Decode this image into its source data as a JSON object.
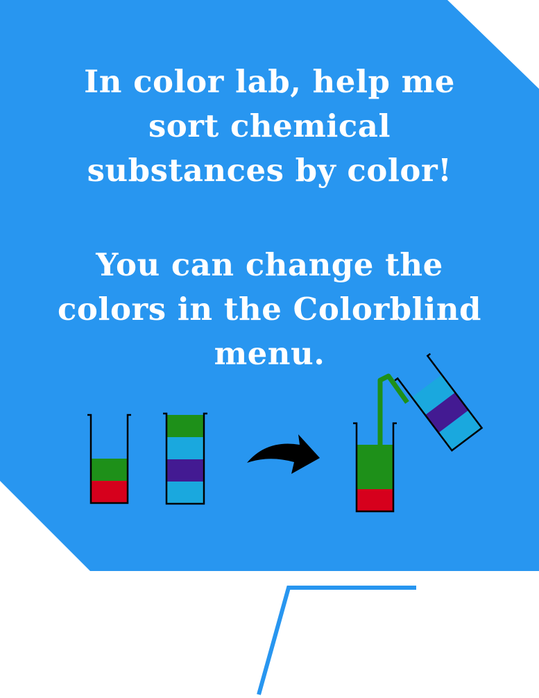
{
  "tutorial": {
    "message_lines": [
      "In color lab, help me",
      "sort chemical",
      "substances by color!"
    ],
    "hint_lines": [
      "You can change the",
      "colors in the Colorblind",
      "menu."
    ]
  },
  "colors": {
    "panel_blue": "#2896f0",
    "green": "#1e9019",
    "red": "#d6001c",
    "cyan": "#1aa8de",
    "purple": "#431a92",
    "outline": "#000000",
    "text": "#ffffff"
  },
  "illustration": {
    "tube_before_left": [
      "red",
      "green"
    ],
    "tube_before_right": [
      "cyan",
      "purple",
      "cyan",
      "green"
    ],
    "tube_after_receiving": [
      "red",
      "green"
    ],
    "tube_after_pouring": [
      "cyan",
      "purple",
      "cyan"
    ],
    "arrow_icon": "curved-arrow-right",
    "pour_stream_color": "green"
  }
}
